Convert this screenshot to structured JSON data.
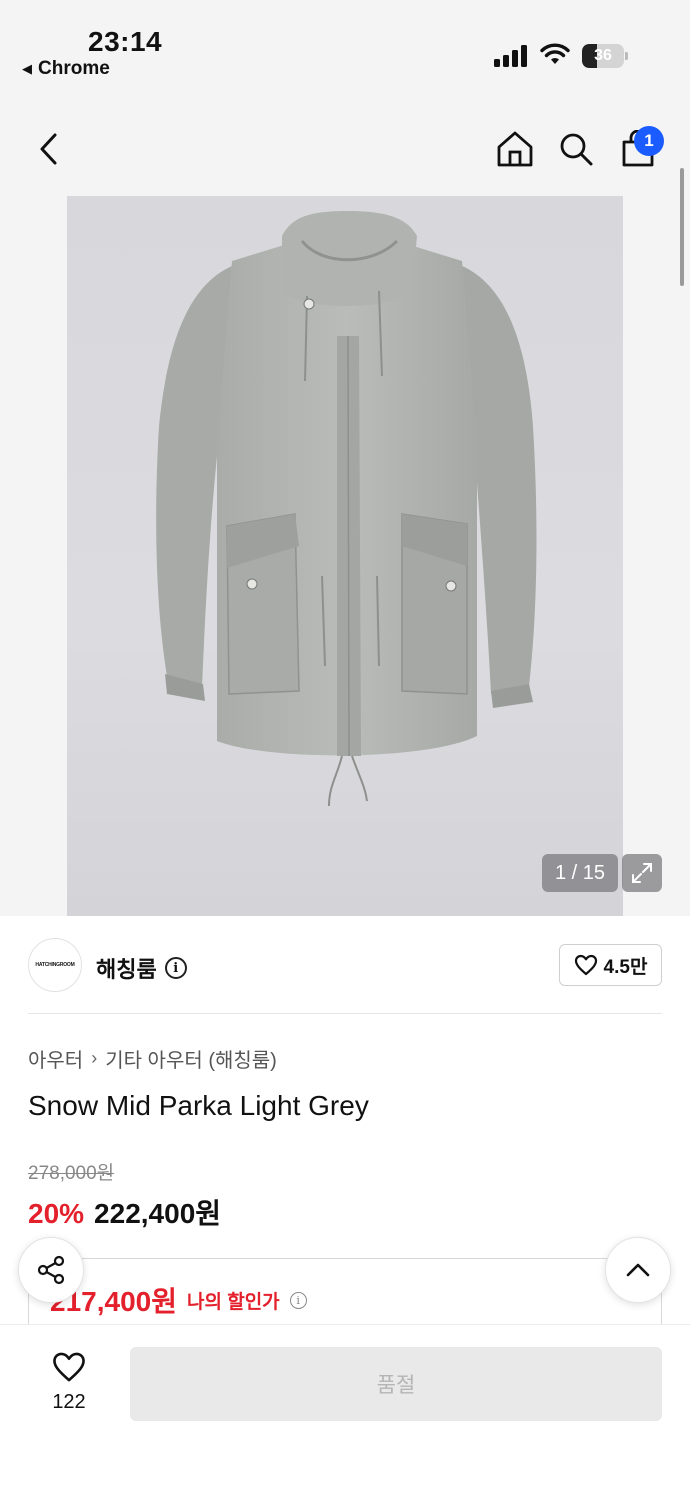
{
  "status_bar": {
    "time": "23:14",
    "back_app": "Chrome",
    "battery": "36",
    "battery_level": 0.36
  },
  "header": {
    "cart_count": "1"
  },
  "gallery": {
    "counter": "1 / 15"
  },
  "brand": {
    "logo_text": "HATCHINGROOM",
    "name": "해칭룸",
    "likes": "4.5만"
  },
  "product": {
    "breadcrumb": [
      "아우터",
      "기타 아우터 (해칭룸)"
    ],
    "title": "Snow Mid Parka Light Grey",
    "original_price": "278,000원",
    "discount_rate": "20%",
    "sale_price": "222,400원",
    "my_price": "217,400원",
    "my_price_label": "나의 할인가"
  },
  "bottom_bar": {
    "wish_count": "122",
    "buy_label": "품절"
  },
  "colors": {
    "accent_red": "#e3202b",
    "badge_blue": "#1a5cff"
  }
}
